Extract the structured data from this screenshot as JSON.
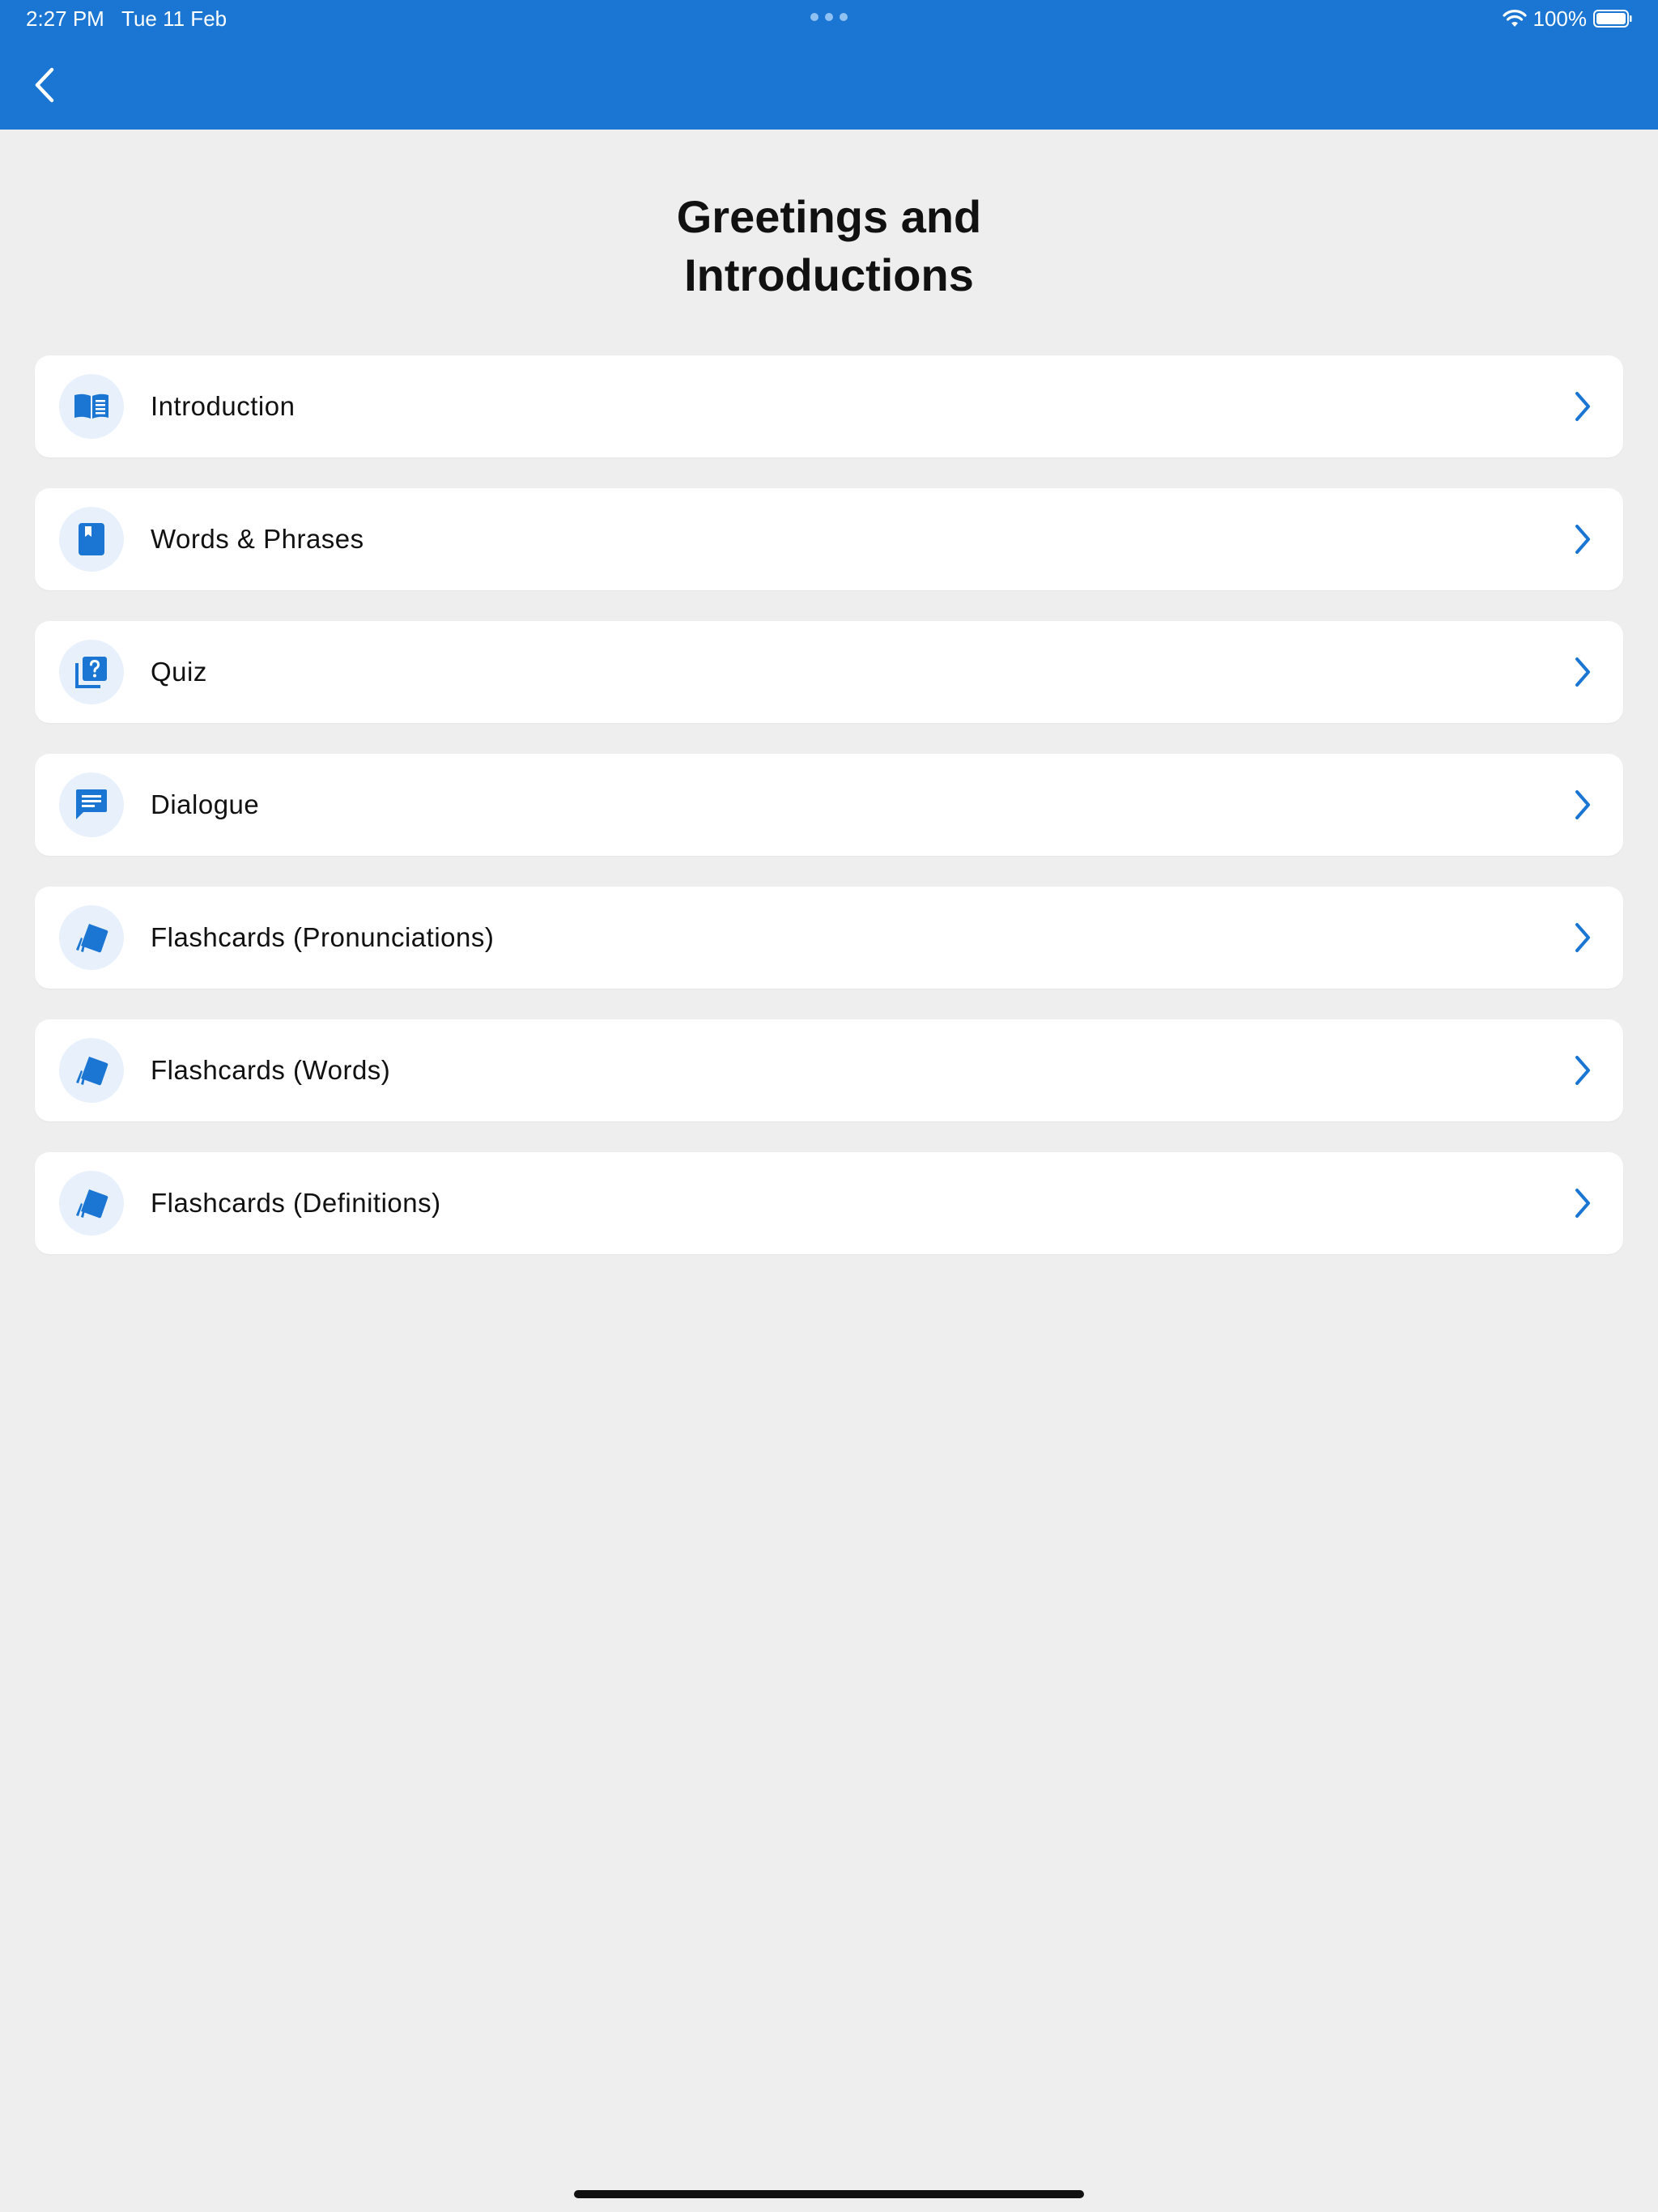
{
  "status_bar": {
    "time": "2:27 PM",
    "date": "Tue 11 Feb",
    "battery": "100%"
  },
  "header": {
    "back_icon": "chevron-left-icon"
  },
  "page": {
    "title_line1": "Greetings and",
    "title_line2": "Introductions"
  },
  "menu": {
    "items": [
      {
        "label": "Introduction",
        "icon": "open-book-icon"
      },
      {
        "label": "Words & Phrases",
        "icon": "bookmark-book-icon"
      },
      {
        "label": "Quiz",
        "icon": "quiz-question-icon"
      },
      {
        "label": "Dialogue",
        "icon": "chat-bubble-icon"
      },
      {
        "label": "Flashcards (Pronunciations)",
        "icon": "flashcards-icon"
      },
      {
        "label": "Flashcards (Words)",
        "icon": "flashcards-icon"
      },
      {
        "label": "Flashcards (Definitions)",
        "icon": "flashcards-icon"
      }
    ]
  },
  "colors": {
    "accent": "#1a76d2",
    "background": "#eeeeee",
    "card": "#ffffff",
    "icon_bg": "#e8f1fb"
  }
}
